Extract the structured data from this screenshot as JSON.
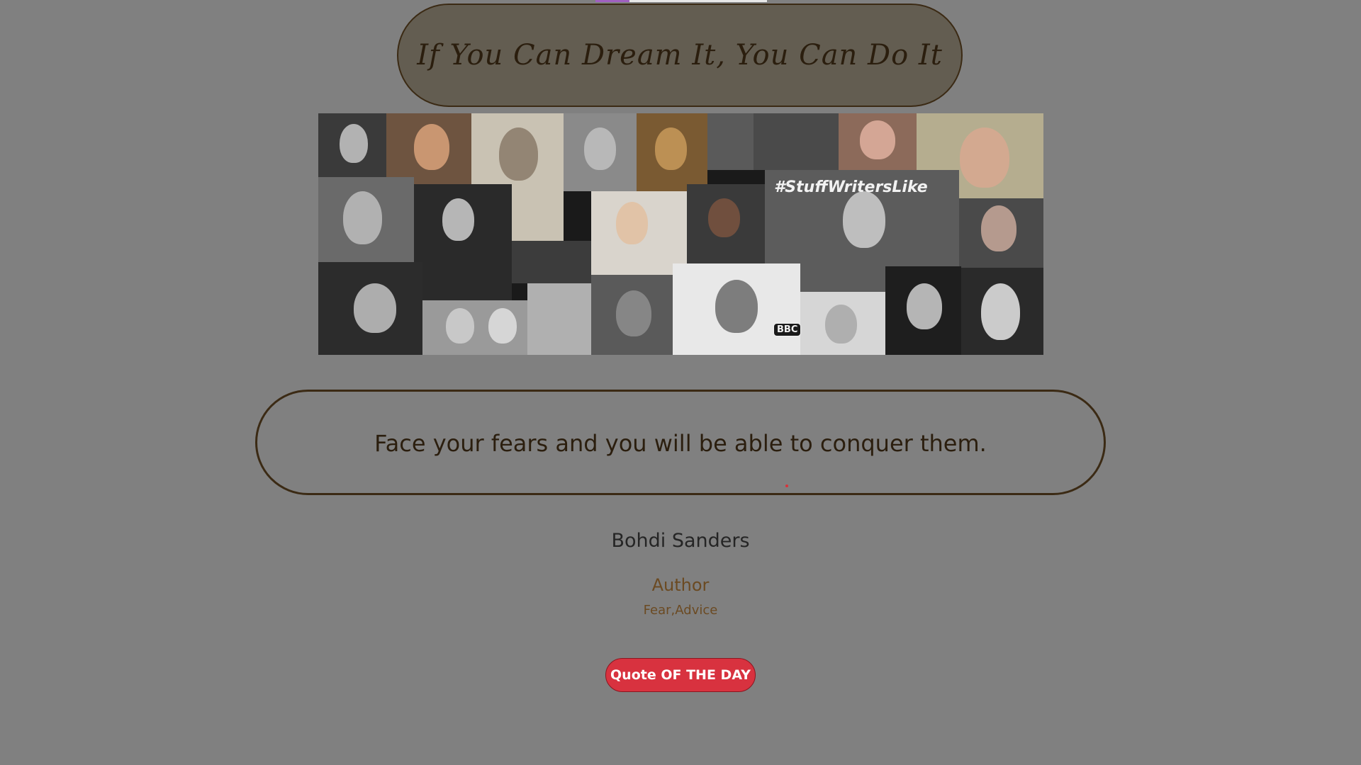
{
  "header": {
    "title": "If You Can Dream It, You Can Do It"
  },
  "collage": {
    "hashtag": "#StuffWritersLike",
    "bbc_label": "BBC"
  },
  "quote": {
    "text": "Face your fears and you will be able to conquer them.",
    "author": "Bohdi Sanders",
    "role": "Author",
    "tags": "Fear,Advice"
  },
  "actions": {
    "quote_of_the_day_label": "Quote OF THE DAY"
  },
  "colors": {
    "background": "#808080",
    "title_pill_fill": "#635d51",
    "border": "#3b2a14",
    "text_dark": "#2b1e0e",
    "role_text": "#6b4a22",
    "button": "#d8323f"
  }
}
